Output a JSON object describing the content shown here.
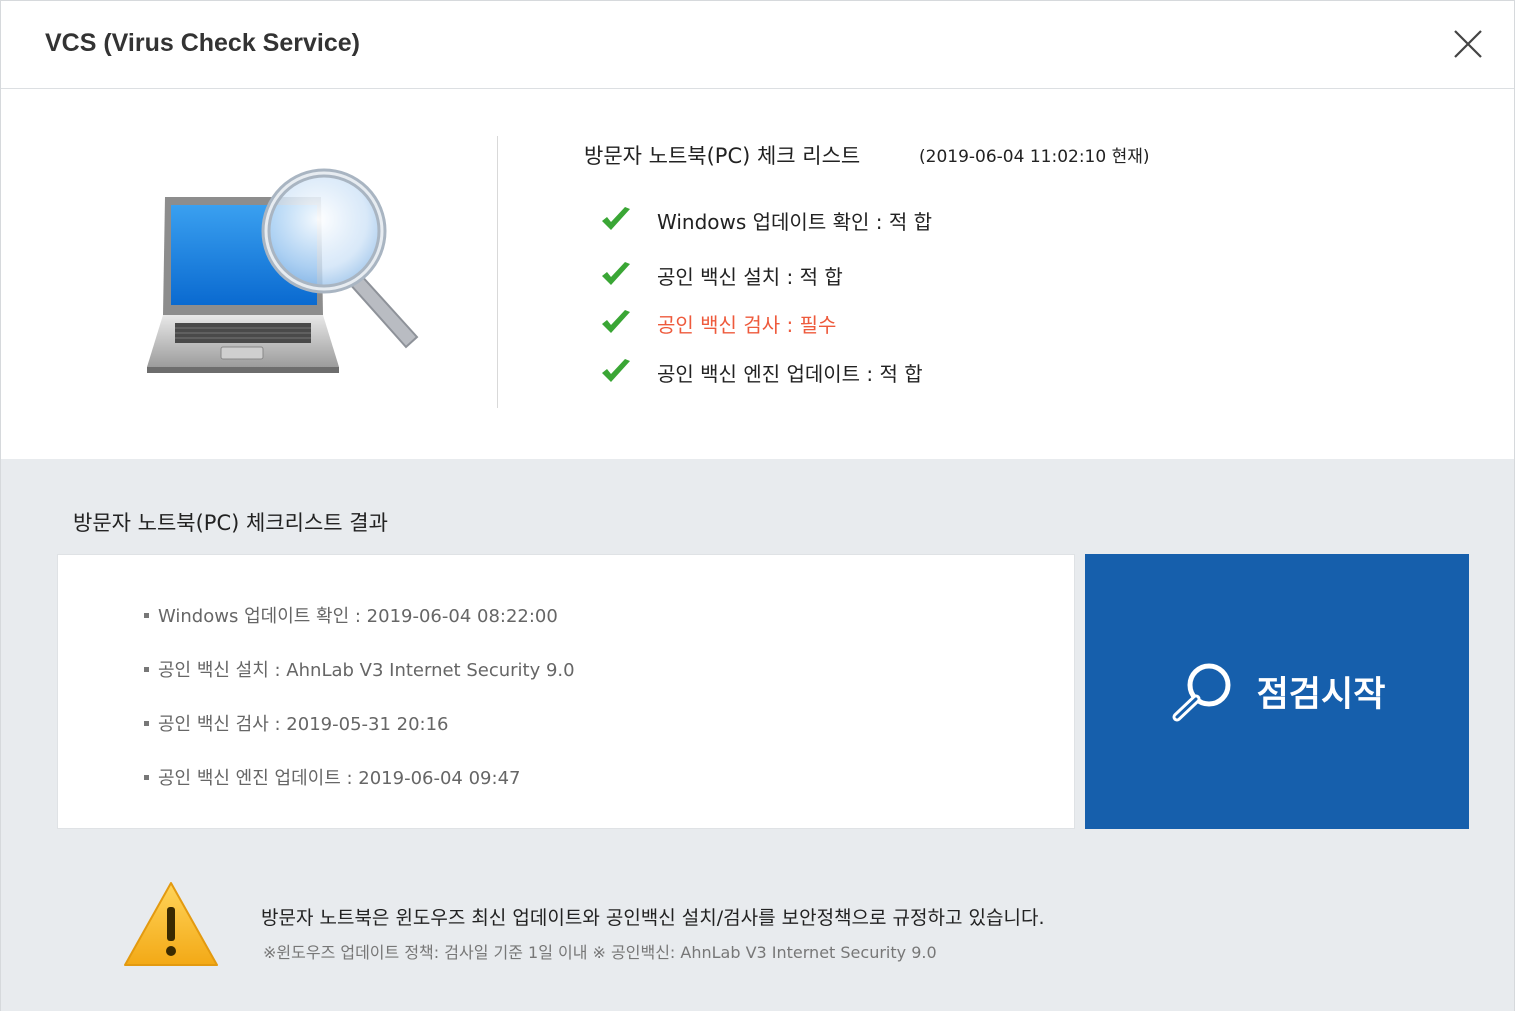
{
  "window": {
    "title": "VCS (Virus Check Service)",
    "close_icon": "close-icon"
  },
  "checklist": {
    "title": "방문자 노트북(PC) 체크 리스트",
    "timestamp": "(2019-06-04 11:02:10 현재)",
    "items": [
      {
        "label": "Windows 업데이트 확인 : 적 합",
        "status": "ok"
      },
      {
        "label": "공인 백신 설치 : 적 합",
        "status": "ok"
      },
      {
        "label": "공인 백신 검사 : 필수",
        "status": "warn"
      },
      {
        "label": "공인 백신 엔진 업데이트 : 적 합",
        "status": "ok"
      }
    ]
  },
  "results": {
    "title": "방문자 노트북(PC) 체크리스트 결과",
    "items": [
      "Windows 업데이트 확인 : 2019-06-04 08:22:00",
      "공인 백신 설치 : AhnLab V3 Internet Security 9.0",
      "공인 백신 검사 : 2019-05-31 20:16",
      "공인 백신 엔진 업데이트 : 2019-06-04 09:47"
    ]
  },
  "start_button": {
    "label": "점검시작",
    "icon": "search-icon"
  },
  "notice": {
    "main": "방문자 노트북은 윈도우즈 최신 업데이트와 공인백신 설치/검사를 보안정책으로 규정하고 있습니다.",
    "sub": "※윈도우즈 업데이트 정책: 검사일 기준 1일 이내   ※ 공인백신: AhnLab V3 Internet Security 9.0"
  },
  "colors": {
    "accent_blue": "#165fac",
    "warning_text": "#ee5a3c",
    "check_green": "#3aa635",
    "background_gray": "#e8ebee"
  }
}
